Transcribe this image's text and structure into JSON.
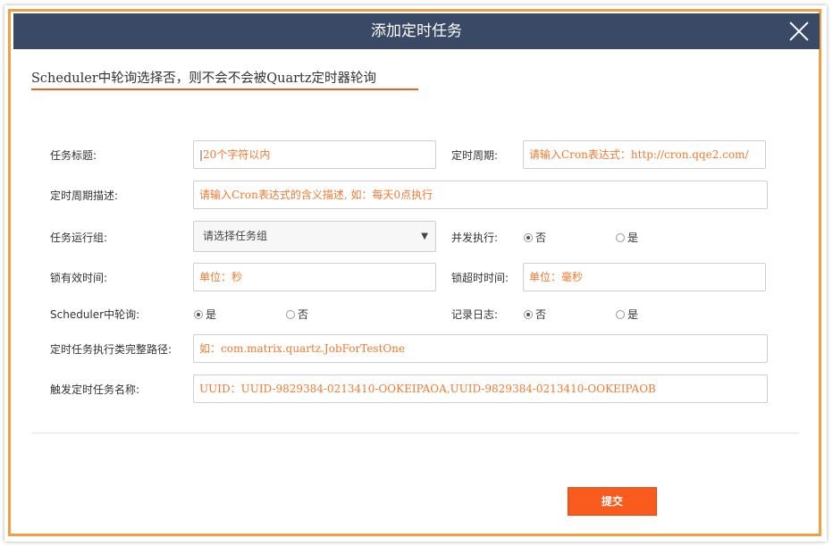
{
  "dialog": {
    "title": "添加定时任务",
    "notice": "Scheduler中轮询选择否，则不会不会被Quartz定时器轮询",
    "submit_label": "提交"
  },
  "form": {
    "task_title": {
      "label": "任务标题:",
      "placeholder": "20个字符以内"
    },
    "cron": {
      "label": "定时周期:",
      "placeholder": "请输入Cron表达式：http://cron.qqe2.com/"
    },
    "cron_desc": {
      "label": "定时周期描述:",
      "placeholder": "请输入Cron表达式的含义描述, 如：每天0点执行"
    },
    "group": {
      "label": "任务运行组:",
      "value": "请选择任务组"
    },
    "concurrent": {
      "label": "并发执行:",
      "options": [
        "否",
        "是"
      ],
      "selected": "否"
    },
    "lock_valid": {
      "label": "锁有效时间:",
      "placeholder": "单位：秒"
    },
    "lock_timeout": {
      "label": "锁超时时间:",
      "placeholder": "单位：毫秒"
    },
    "scheduler_poll": {
      "label": "Scheduler中轮询:",
      "options": [
        "是",
        "否"
      ],
      "selected": "是"
    },
    "log": {
      "label": "记录日志:",
      "options": [
        "否",
        "是"
      ],
      "selected": "否"
    },
    "class_path": {
      "label": "定时任务执行类完整路径:",
      "placeholder": "如：com.matrix.quartz.JobForTestOne"
    },
    "trigger_name": {
      "label": "触发定时任务名称:",
      "placeholder": "UUID：UUID-9829384-0213410-OOKEIPAOA,UUID-9829384-0213410-OOKEIPAOB"
    }
  },
  "colors": {
    "header": "#3a4a66",
    "accent": "#f95b1e",
    "frame": "#f0a040",
    "placeholder": "#f07a30"
  }
}
